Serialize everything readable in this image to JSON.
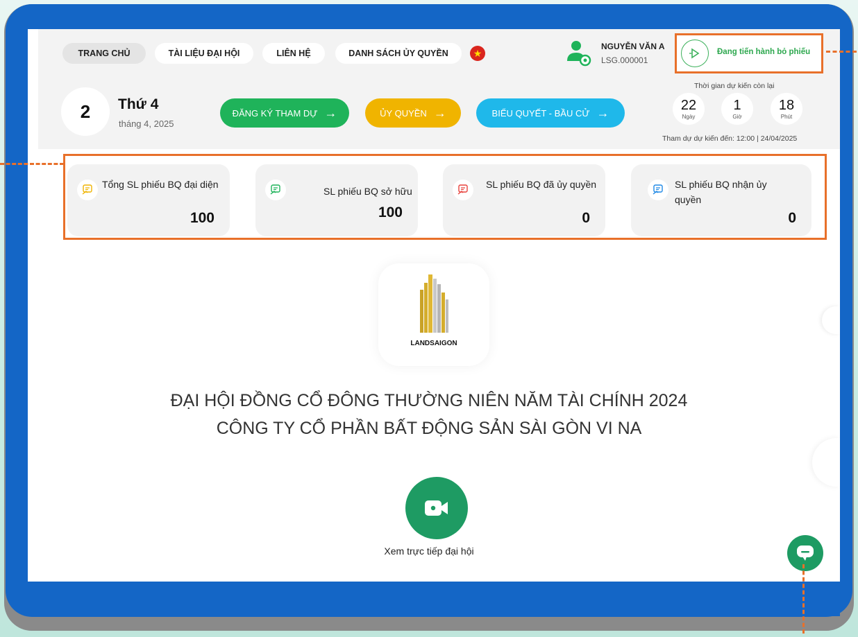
{
  "nav": {
    "home": "TRANG CHỦ",
    "docs": "TÀI LIỆU ĐẠI HỘI",
    "contact": "LIÊN HỆ",
    "proxy_list": "DANH SÁCH ỦY QUYỀN",
    "flag_glyph": "★"
  },
  "user": {
    "name": "NGUYỄN VĂN A",
    "code": "LSG.000001"
  },
  "vote_status": {
    "label": "Đang tiến hành bỏ phiếu",
    "icon": "play-circle-icon"
  },
  "date": {
    "day": "2",
    "weekday": "Thứ 4",
    "month_year": "tháng 4, 2025"
  },
  "actions": {
    "register": "ĐĂNG KÝ THAM DỰ",
    "proxy": "ỦY QUYỀN",
    "vote": "BIỂU QUYẾT - BẦU CỬ",
    "arrow": "→",
    "colors": {
      "register": "#1fb35a",
      "proxy": "#f0b400",
      "vote": "#1fb8ea"
    }
  },
  "countdown": {
    "title": "Thời gian dự kiến còn lại",
    "days": "22",
    "days_unit": "Ngày",
    "hours": "1",
    "hours_unit": "Giờ",
    "minutes": "18",
    "minutes_unit": "Phút",
    "footer": "Tham dự dự kiến đến: 12:00 | 24/04/2025"
  },
  "stats": [
    {
      "label": "Tổng SL phiếu BQ đại diện",
      "value": "100",
      "icon_color": "#f0b400"
    },
    {
      "label": "SL phiếu BQ sở hữu",
      "value": "100",
      "icon_color": "#1fb35a"
    },
    {
      "label": "SL phiếu BQ đã ủy quyền",
      "value": "0",
      "icon_color": "#e8413c"
    },
    {
      "label": "SL phiếu BQ nhận ủy quyền",
      "value": "0",
      "icon_color": "#1e88e5"
    }
  ],
  "logo": {
    "text": "LANDSAIGON"
  },
  "headline": {
    "line1": "ĐẠI HỘI ĐỒNG CỔ ĐÔNG THƯỜNG NIÊN NĂM TÀI CHÍNH 2024",
    "line2": "CÔNG TY CỔ PHẦN BẤT ĐỘNG SẢN SÀI GÒN VI NA"
  },
  "live": {
    "label": "Xem trực tiếp đại hội",
    "icon": "video-camera-icon"
  },
  "chat": {
    "icon": "chat-bubble-icon"
  },
  "accent": {
    "highlight": "#e8702a",
    "frame_blue": "#1466c6",
    "brand_green": "#1e9b63"
  }
}
